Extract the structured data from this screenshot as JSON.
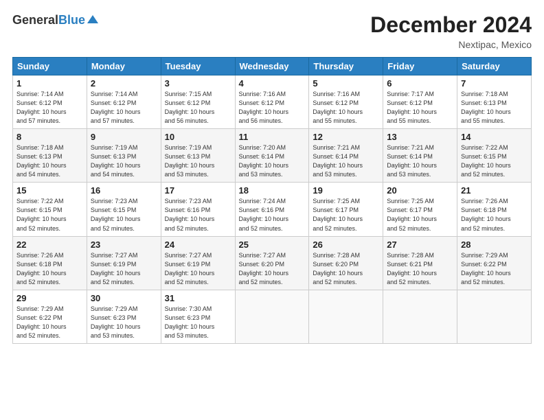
{
  "logo": {
    "general": "General",
    "blue": "Blue"
  },
  "title": "December 2024",
  "location": "Nextipac, Mexico",
  "headers": [
    "Sunday",
    "Monday",
    "Tuesday",
    "Wednesday",
    "Thursday",
    "Friday",
    "Saturday"
  ],
  "weeks": [
    [
      {
        "day": "1",
        "sunrise": "7:14 AM",
        "sunset": "6:12 PM",
        "daylight": "10 hours and 57 minutes."
      },
      {
        "day": "2",
        "sunrise": "7:14 AM",
        "sunset": "6:12 PM",
        "daylight": "10 hours and 57 minutes."
      },
      {
        "day": "3",
        "sunrise": "7:15 AM",
        "sunset": "6:12 PM",
        "daylight": "10 hours and 56 minutes."
      },
      {
        "day": "4",
        "sunrise": "7:16 AM",
        "sunset": "6:12 PM",
        "daylight": "10 hours and 56 minutes."
      },
      {
        "day": "5",
        "sunrise": "7:16 AM",
        "sunset": "6:12 PM",
        "daylight": "10 hours and 55 minutes."
      },
      {
        "day": "6",
        "sunrise": "7:17 AM",
        "sunset": "6:12 PM",
        "daylight": "10 hours and 55 minutes."
      },
      {
        "day": "7",
        "sunrise": "7:18 AM",
        "sunset": "6:13 PM",
        "daylight": "10 hours and 55 minutes."
      }
    ],
    [
      {
        "day": "8",
        "sunrise": "7:18 AM",
        "sunset": "6:13 PM",
        "daylight": "10 hours and 54 minutes."
      },
      {
        "day": "9",
        "sunrise": "7:19 AM",
        "sunset": "6:13 PM",
        "daylight": "10 hours and 54 minutes."
      },
      {
        "day": "10",
        "sunrise": "7:19 AM",
        "sunset": "6:13 PM",
        "daylight": "10 hours and 53 minutes."
      },
      {
        "day": "11",
        "sunrise": "7:20 AM",
        "sunset": "6:14 PM",
        "daylight": "10 hours and 53 minutes."
      },
      {
        "day": "12",
        "sunrise": "7:21 AM",
        "sunset": "6:14 PM",
        "daylight": "10 hours and 53 minutes."
      },
      {
        "day": "13",
        "sunrise": "7:21 AM",
        "sunset": "6:14 PM",
        "daylight": "10 hours and 53 minutes."
      },
      {
        "day": "14",
        "sunrise": "7:22 AM",
        "sunset": "6:15 PM",
        "daylight": "10 hours and 52 minutes."
      }
    ],
    [
      {
        "day": "15",
        "sunrise": "7:22 AM",
        "sunset": "6:15 PM",
        "daylight": "10 hours and 52 minutes."
      },
      {
        "day": "16",
        "sunrise": "7:23 AM",
        "sunset": "6:15 PM",
        "daylight": "10 hours and 52 minutes."
      },
      {
        "day": "17",
        "sunrise": "7:23 AM",
        "sunset": "6:16 PM",
        "daylight": "10 hours and 52 minutes."
      },
      {
        "day": "18",
        "sunrise": "7:24 AM",
        "sunset": "6:16 PM",
        "daylight": "10 hours and 52 minutes."
      },
      {
        "day": "19",
        "sunrise": "7:25 AM",
        "sunset": "6:17 PM",
        "daylight": "10 hours and 52 minutes."
      },
      {
        "day": "20",
        "sunrise": "7:25 AM",
        "sunset": "6:17 PM",
        "daylight": "10 hours and 52 minutes."
      },
      {
        "day": "21",
        "sunrise": "7:26 AM",
        "sunset": "6:18 PM",
        "daylight": "10 hours and 52 minutes."
      }
    ],
    [
      {
        "day": "22",
        "sunrise": "7:26 AM",
        "sunset": "6:18 PM",
        "daylight": "10 hours and 52 minutes."
      },
      {
        "day": "23",
        "sunrise": "7:27 AM",
        "sunset": "6:19 PM",
        "daylight": "10 hours and 52 minutes."
      },
      {
        "day": "24",
        "sunrise": "7:27 AM",
        "sunset": "6:19 PM",
        "daylight": "10 hours and 52 minutes."
      },
      {
        "day": "25",
        "sunrise": "7:27 AM",
        "sunset": "6:20 PM",
        "daylight": "10 hours and 52 minutes."
      },
      {
        "day": "26",
        "sunrise": "7:28 AM",
        "sunset": "6:20 PM",
        "daylight": "10 hours and 52 minutes."
      },
      {
        "day": "27",
        "sunrise": "7:28 AM",
        "sunset": "6:21 PM",
        "daylight": "10 hours and 52 minutes."
      },
      {
        "day": "28",
        "sunrise": "7:29 AM",
        "sunset": "6:22 PM",
        "daylight": "10 hours and 52 minutes."
      }
    ],
    [
      {
        "day": "29",
        "sunrise": "7:29 AM",
        "sunset": "6:22 PM",
        "daylight": "10 hours and 52 minutes."
      },
      {
        "day": "30",
        "sunrise": "7:29 AM",
        "sunset": "6:23 PM",
        "daylight": "10 hours and 53 minutes."
      },
      {
        "day": "31",
        "sunrise": "7:30 AM",
        "sunset": "6:23 PM",
        "daylight": "10 hours and 53 minutes."
      },
      null,
      null,
      null,
      null
    ]
  ],
  "labels": {
    "sunrise": "Sunrise:",
    "sunset": "Sunset:",
    "daylight": "Daylight:"
  }
}
